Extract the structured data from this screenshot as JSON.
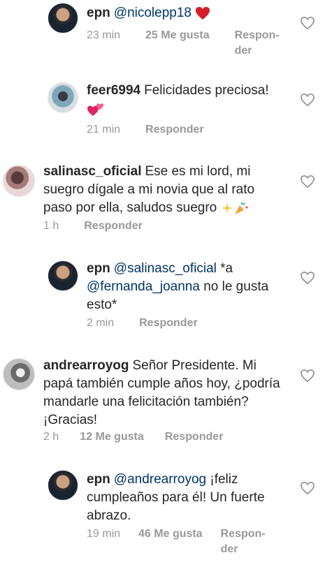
{
  "comments": [
    {
      "user": "epn",
      "pre": "",
      "mention": "@nicolepp18",
      "post": "",
      "time": "23 min",
      "likes": "25 Me gusta",
      "reply": "Responder",
      "emoji": "red-heart"
    },
    {
      "user": "feer6994",
      "body": "Felicidades preciosa!",
      "time": "21 min",
      "reply": "Responder",
      "emoji": "two-hearts"
    },
    {
      "user": "salinasc_oficial",
      "body_l1": "Ese es mi lord, mi",
      "body_l2": "suegro dígale a mi novia que al rato",
      "body_l3": "paso por ella, saludos suegro",
      "time": "1 h",
      "reply": "Responder",
      "emoji": "sparkles-confetti"
    },
    {
      "user": "epn",
      "mention1": "@salinasc_oficial",
      "post1": "*a",
      "mention2": "@fernanda_joanna",
      "post2": "no le gusta",
      "post3": "esto*",
      "time": "2 min",
      "reply": "Responder"
    },
    {
      "user": "andrearroyog",
      "body_l1": "Señor Presidente. Mi",
      "body_l2": "papá también cumple años hoy, ¿podría",
      "body_l3": "mandarle una felicitación también?",
      "body_l4": "¡Gracias!",
      "time": "2 h",
      "likes": "12 Me gusta",
      "reply": "Responder"
    },
    {
      "user": "epn",
      "mention": "@andrearroyog",
      "body_l1": "¡feliz",
      "body_l2": "cumpleaños para él! Un fuerte",
      "body_l3": "abrazo.",
      "time": "19 min",
      "likes": "46 Me gusta",
      "reply": "Responder"
    }
  ],
  "icons": {
    "like": "heart-outline-icon"
  },
  "colors": {
    "text": "#262626",
    "meta": "#999999",
    "mention": "#003569"
  }
}
